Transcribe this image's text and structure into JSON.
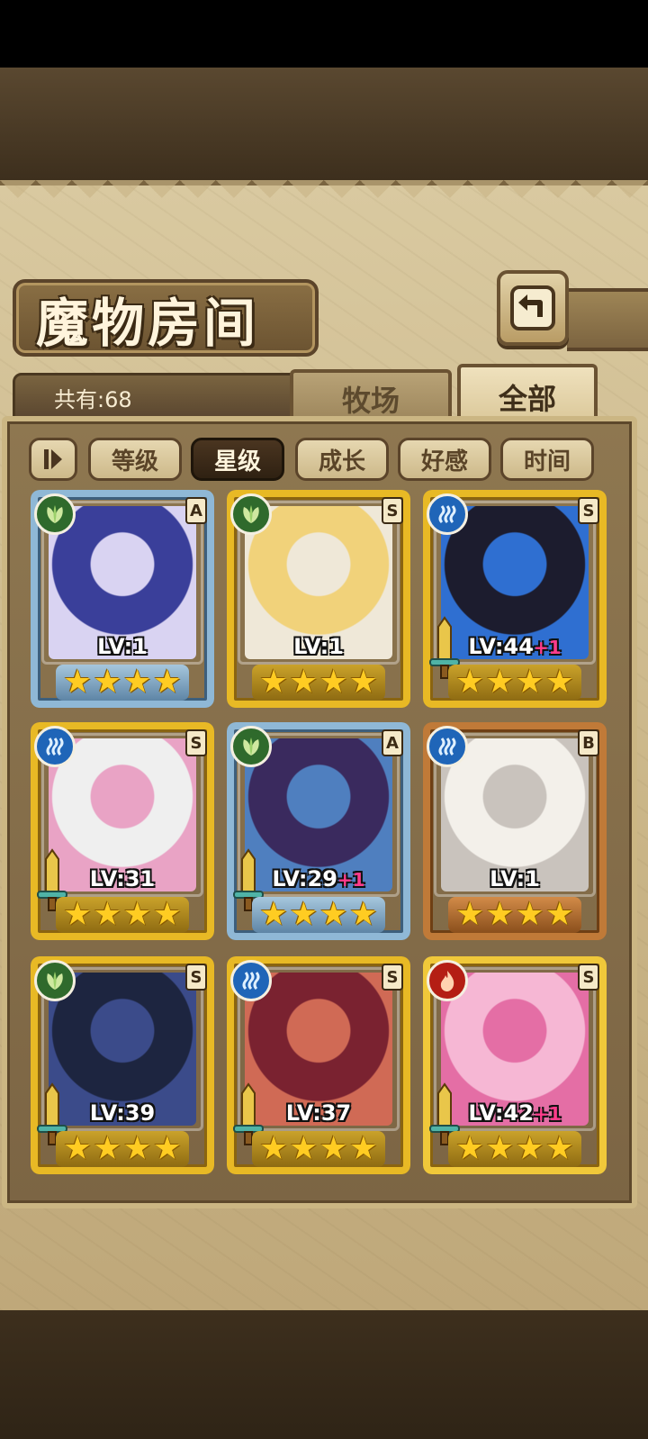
{
  "title": "魔物房间",
  "total_label": "共有:68",
  "tabs": {
    "ranch": "牧场",
    "all": "全部"
  },
  "sort_buttons": [
    "等级",
    "星级",
    "成长",
    "好感",
    "时间"
  ],
  "active_sort": "星级",
  "monsters": [
    {
      "element": "grass",
      "rank": "A",
      "level": "LV:1",
      "bonus": "",
      "stars": 4,
      "frame": "silver",
      "sword": false,
      "art": [
        "#3a3f9a",
        "#d9d3f2"
      ]
    },
    {
      "element": "grass",
      "rank": "S",
      "level": "LV:1",
      "bonus": "",
      "stars": 4,
      "frame": "gold",
      "sword": false,
      "art": [
        "#f1d27a",
        "#efe8d8"
      ]
    },
    {
      "element": "water",
      "rank": "S",
      "level": "LV:44",
      "bonus": "+1",
      "stars": 4,
      "frame": "gold",
      "sword": true,
      "art": [
        "#1c1c2e",
        "#2f6fd1"
      ]
    },
    {
      "element": "water",
      "rank": "S",
      "level": "LV:31",
      "bonus": "",
      "stars": 4,
      "frame": "gold",
      "sword": true,
      "art": [
        "#efefef",
        "#e9a3c5"
      ]
    },
    {
      "element": "grass",
      "rank": "A",
      "level": "LV:29",
      "bonus": "+1",
      "stars": 4,
      "frame": "silver",
      "sword": true,
      "art": [
        "#3a2a5e",
        "#4f7fbf"
      ]
    },
    {
      "element": "water",
      "rank": "B",
      "level": "LV:1",
      "bonus": "",
      "stars": 4,
      "frame": "bronze",
      "sword": false,
      "art": [
        "#f3f0ea",
        "#c9c3bd"
      ]
    },
    {
      "element": "grass",
      "rank": "S",
      "level": "LV:39",
      "bonus": "",
      "stars": 4,
      "frame": "gold",
      "sword": true,
      "art": [
        "#1d2540",
        "#3b4b8a"
      ]
    },
    {
      "element": "water",
      "rank": "S",
      "level": "LV:37",
      "bonus": "",
      "stars": 4,
      "frame": "gold",
      "sword": true,
      "art": [
        "#7a2230",
        "#d06a55"
      ]
    },
    {
      "element": "fire",
      "rank": "S",
      "level": "LV:42",
      "bonus": "+1",
      "stars": 4,
      "frame": "pink",
      "sword": true,
      "art": [
        "#f6b7d4",
        "#e46ea5"
      ]
    }
  ]
}
